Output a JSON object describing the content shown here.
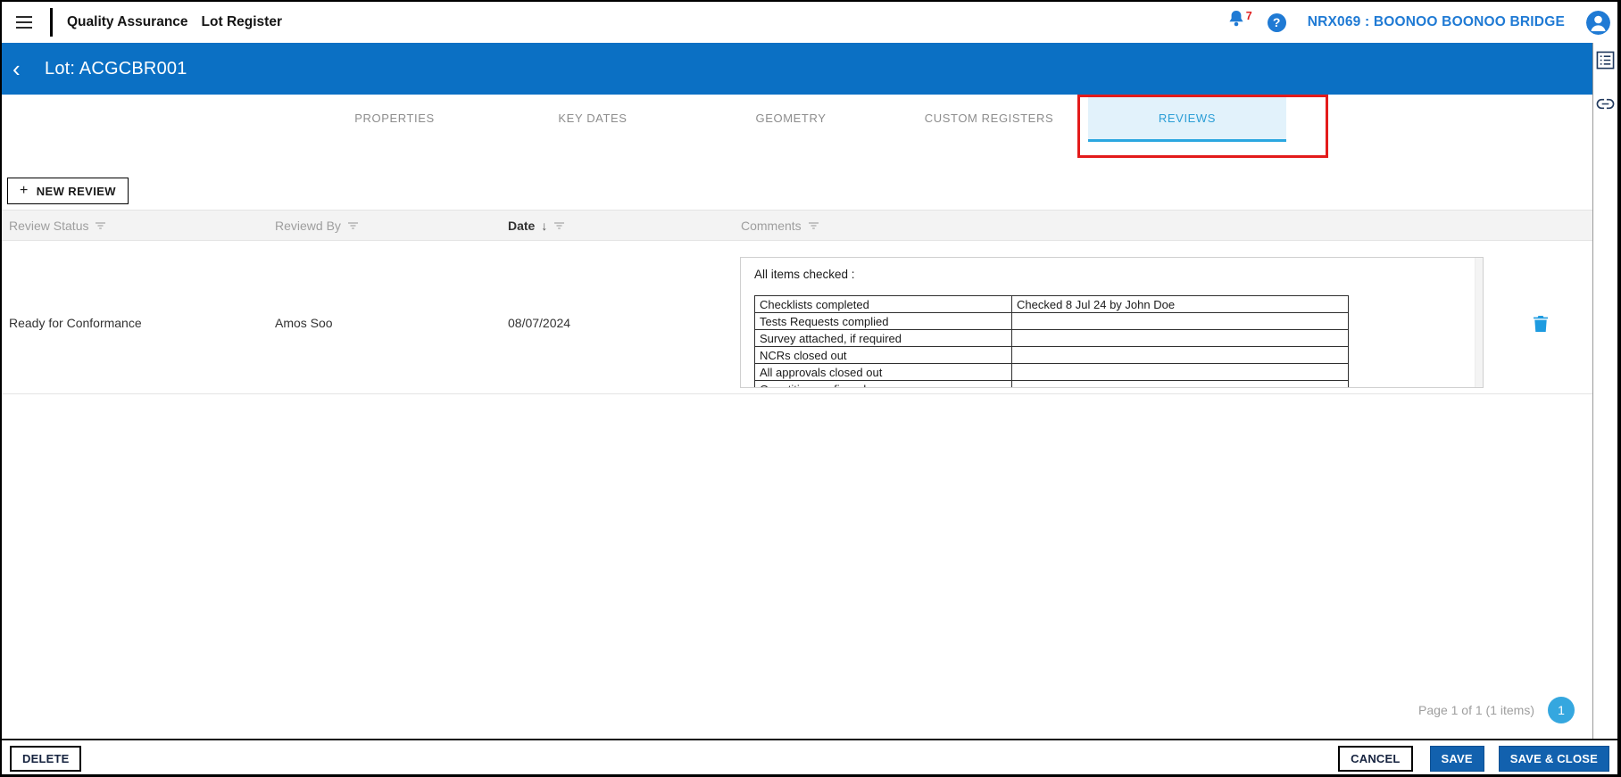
{
  "top_bar": {
    "app_title": "Quality Assurance",
    "module_title": "Lot Register",
    "notification_badge": "7",
    "help_glyph": "?",
    "project_name": "NRX069 : BOONOO BOONOO BRIDGE"
  },
  "lot_header": {
    "back_glyph": "‹",
    "title": "Lot: ACGCBR001"
  },
  "tabs": {
    "active": "REVIEWS",
    "items": [
      {
        "label": "PROPERTIES"
      },
      {
        "label": "KEY DATES"
      },
      {
        "label": "GEOMETRY"
      },
      {
        "label": "CUSTOM REGISTERS"
      },
      {
        "label": "REVIEWS"
      }
    ]
  },
  "toolbar": {
    "plus_glyph": "+",
    "new_review_label": "NEW REVIEW"
  },
  "grid": {
    "headers": {
      "review_status": "Review Status",
      "reviewed_by": "Reviewd By",
      "date": "Date",
      "sort_glyph": "↓",
      "comments": "Comments"
    },
    "rows": [
      {
        "review_status": "Ready for Conformance",
        "reviewed_by": "Amos Soo",
        "date": "08/07/2024",
        "comments_intro": "All items checked :",
        "checklist": [
          {
            "item": "Checklists completed",
            "value": "Checked 8 Jul 24 by John Doe"
          },
          {
            "item": "Tests Requests complied",
            "value": ""
          },
          {
            "item": "Survey attached, if required",
            "value": ""
          },
          {
            "item": "NCRs closed out",
            "value": ""
          },
          {
            "item": "All approvals closed out",
            "value": ""
          },
          {
            "item": "Quantities confirmed",
            "value": ""
          }
        ]
      }
    ]
  },
  "pagination": {
    "summary": "Page 1 of 1 (1 items)",
    "page": "1"
  },
  "footer": {
    "delete_label": "DELETE",
    "cancel_label": "CANCEL",
    "save_label": "SAVE",
    "save_and_close_label": "SAVE & CLOSE"
  },
  "icons": {
    "menu-icon": "hamburger three lines",
    "bell-icon": "notification bell (blue)",
    "help-icon": "question mark in blue circle",
    "avatar-icon": "user silhouette in blue circle",
    "back-icon": "left chevron",
    "form-panel-icon": "list inside square",
    "link-panel-icon": "chain link",
    "filter-icon": "funnel lines",
    "sort-desc-icon": "down arrow",
    "trash-icon": "blue trash can"
  },
  "colors": {
    "lot_bar_blue": "#0b70c4",
    "accent_blue": "#1f7ad4",
    "active_tab_blue": "#2b9ed6",
    "tab_underline_blue": "#2ba7e0",
    "active_tab_bg": "#e2f2fb",
    "button_blue": "#1261ae",
    "page_circle_blue": "#35a7df",
    "badge_red": "#e02020",
    "annotation_red": "#e31b1b",
    "trash_blue": "#1e9be0",
    "header_row_gray": "#f3f3f3"
  }
}
